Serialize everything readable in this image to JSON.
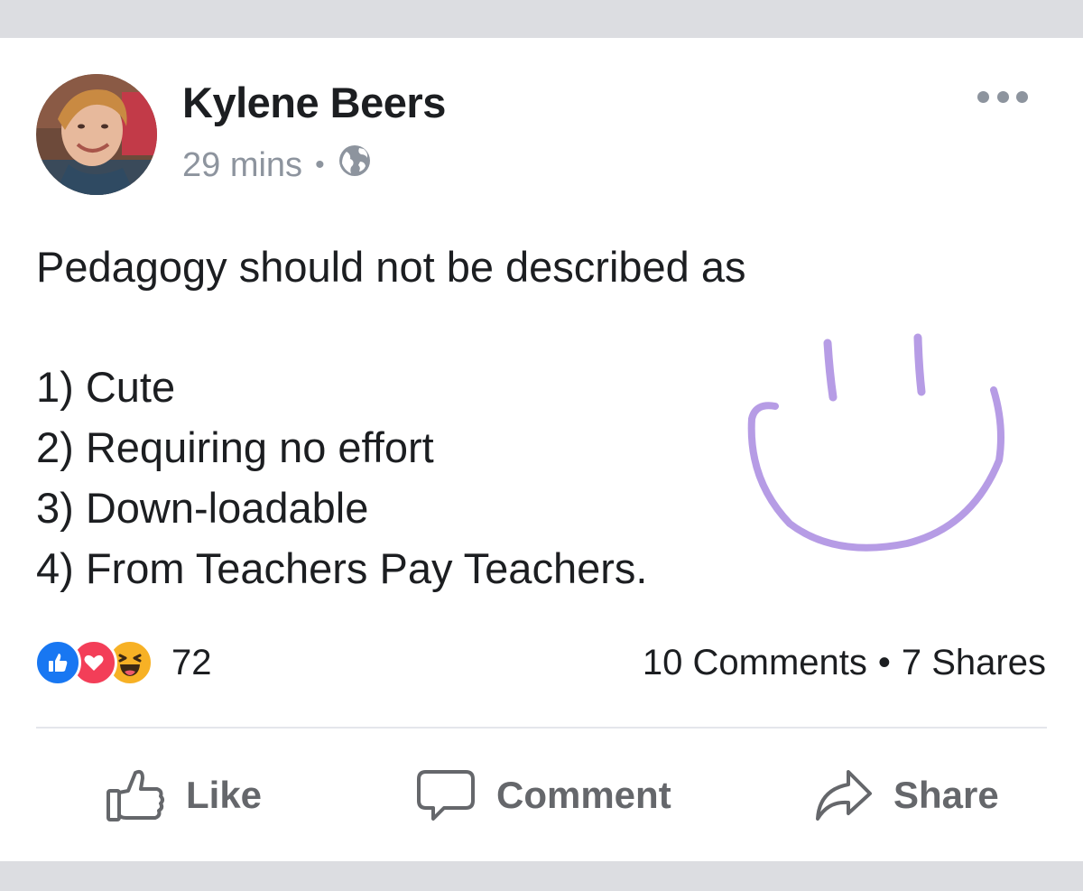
{
  "post": {
    "author": "Kylene Beers",
    "time": "29 mins",
    "separator": "•",
    "privacy_icon": "globe-icon",
    "menu_icon": "more-options-icon",
    "text_lines": [
      "Pedagogy should not be described as",
      "1) Cute",
      "2) Requiring no effort",
      "3) Down-loadable",
      "4) From Teachers Pay Teachers."
    ],
    "doodle": "purple-smiley-drawing"
  },
  "reactions": {
    "icons": [
      "like-reaction-icon",
      "love-reaction-icon",
      "haha-reaction-icon"
    ],
    "count": "72"
  },
  "stats": {
    "comments": "10 Comments",
    "separator": "•",
    "shares": "7 Shares"
  },
  "actions": {
    "like": "Like",
    "comment": "Comment",
    "share": "Share"
  },
  "colors": {
    "like_blue": "#1877f2",
    "love_red": "#f33e58",
    "haha_yellow": "#f7b125",
    "doodle_purple": "#a98be0",
    "secondary_text": "#8d949e"
  }
}
